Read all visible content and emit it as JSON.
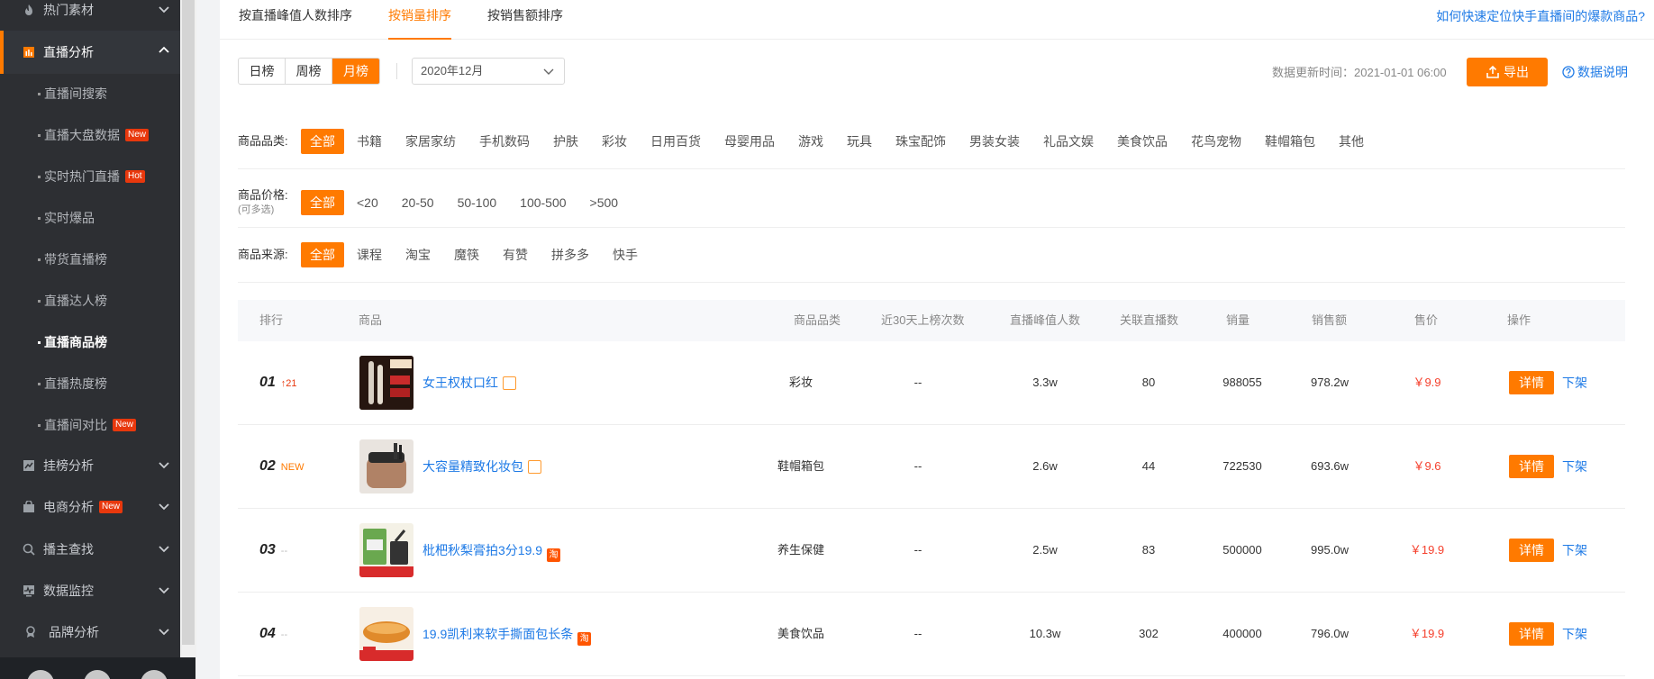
{
  "sidebar": {
    "items": [
      {
        "label": "热门素材",
        "icon": "fire-icon"
      },
      {
        "label": "直播分析",
        "icon": "bar-chart-icon",
        "active": true
      },
      {
        "label": "挂榜分析",
        "icon": "line-chart-icon"
      },
      {
        "label": "电商分析",
        "icon": "shop-bag-icon",
        "badge": "New"
      },
      {
        "label": "播主查找",
        "icon": "search-icon"
      },
      {
        "label": "数据监控",
        "icon": "monitor-icon"
      },
      {
        "label": "品牌分析",
        "icon": "medal-icon"
      }
    ],
    "sub_items": [
      {
        "label": "直播间搜索"
      },
      {
        "label": "直播大盘数据",
        "badge": "New"
      },
      {
        "label": "实时热门直播",
        "badge": "Hot"
      },
      {
        "label": "实时爆品"
      },
      {
        "label": "带货直播榜"
      },
      {
        "label": "直播达人榜"
      },
      {
        "label": "直播商品榜",
        "current": true
      },
      {
        "label": "直播热度榜"
      },
      {
        "label": "直播间对比",
        "badge": "New"
      }
    ]
  },
  "tabs": [
    {
      "label": "按直播峰值人数排序"
    },
    {
      "label": "按销量排序",
      "active": true
    },
    {
      "label": "按销售额排序"
    }
  ],
  "help_link": "如何快速定位快手直播间的爆款商品?",
  "period": {
    "options": [
      "日榜",
      "周榜",
      "月榜"
    ],
    "selected": "月榜"
  },
  "date_select": {
    "value": "2020年12月"
  },
  "update_time": "数据更新时间：2021-01-01 06:00",
  "export_label": "导出",
  "data_desc_label": "数据说明",
  "filters": {
    "category": {
      "label": "商品品类:",
      "options": [
        "全部",
        "书籍",
        "家居家纺",
        "手机数码",
        "护肤",
        "彩妆",
        "日用百货",
        "母婴用品",
        "游戏",
        "玩具",
        "珠宝配饰",
        "男装女装",
        "礼品文娱",
        "美食饮品",
        "花鸟宠物",
        "鞋帽箱包",
        "其他"
      ]
    },
    "price": {
      "label": "商品价格:",
      "sublabel": "(可多选)",
      "options": [
        "全部",
        "<20",
        "20-50",
        "50-100",
        "100-500",
        ">500"
      ]
    },
    "source": {
      "label": "商品来源:",
      "options": [
        "全部",
        "课程",
        "淘宝",
        "魔筷",
        "有赞",
        "拼多多",
        "快手"
      ]
    }
  },
  "table": {
    "headers": [
      "排行",
      "商品",
      "商品品类",
      "近30天上榜次数",
      "直播峰值人数",
      "关联直播数",
      "销量",
      "销售额",
      "售价",
      "操作"
    ],
    "detail_label": "详情",
    "offshelf_label": "下架",
    "rows": [
      {
        "rank": "01",
        "trend": "21",
        "trend_type": "up",
        "name": "女王权杖口红",
        "platform": "box",
        "category": "彩妆",
        "times": "--",
        "peak": "3.3w",
        "lives": "80",
        "sales": "988055",
        "revenue": "978.2w",
        "price": "￥9.9"
      },
      {
        "rank": "02",
        "trend": "NEW",
        "trend_type": "new",
        "name": "大容量精致化妆包",
        "platform": "box",
        "category": "鞋帽箱包",
        "times": "--",
        "peak": "2.6w",
        "lives": "44",
        "sales": "722530",
        "revenue": "693.6w",
        "price": "￥9.6"
      },
      {
        "rank": "03",
        "trend": "--",
        "trend_type": "flat",
        "name": "枇杷秋梨膏拍3分19.9",
        "platform": "taobao",
        "platform_glyph": "淘",
        "category": "养生保健",
        "times": "--",
        "peak": "2.5w",
        "lives": "83",
        "sales": "500000",
        "revenue": "995.0w",
        "price": "￥19.9"
      },
      {
        "rank": "04",
        "trend": "--",
        "trend_type": "flat",
        "name": "19.9凯利来软手撕面包长条",
        "platform": "taobao",
        "platform_glyph": "淘",
        "category": "美食饮品",
        "times": "--",
        "peak": "10.3w",
        "lives": "302",
        "sales": "400000",
        "revenue": "796.0w",
        "price": "￥19.9"
      }
    ]
  },
  "colors": {
    "accent": "#ff7a00",
    "link": "#1e7ae6",
    "price": "#f5402d",
    "sidebar_bg": "#2d2f33"
  }
}
